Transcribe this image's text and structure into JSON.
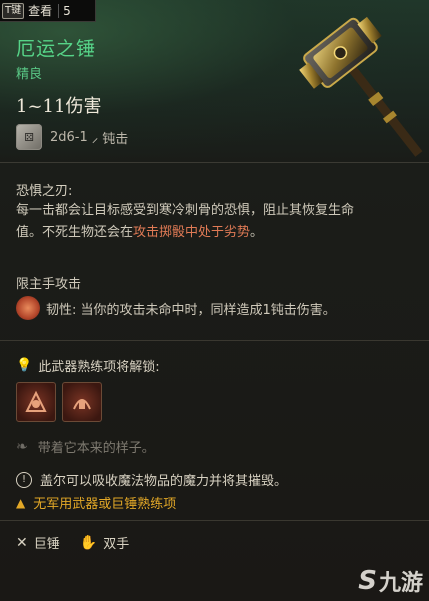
{
  "key_hint": {
    "key": "T键",
    "label": "查看",
    "count": "5"
  },
  "item": {
    "name": "厄运之锤",
    "rarity": "精良",
    "damage": "1~11伤害",
    "dice": "2d6-1",
    "damage_type": "钝击",
    "art_icon": "warhammer-icon"
  },
  "passive": {
    "title": "恐惧之刃:",
    "desc_part1": "每一击都会让目标感受到寒冷刺骨的恐惧，阻止其恢复生命值。不死生物还会在",
    "desc_highlight": "攻击掷骰中处于劣势",
    "desc_part2": "。"
  },
  "restriction": "限主手攻击",
  "toughness": {
    "label": "韧性:",
    "desc": "当你的攻击未命中时，同样造成1钝击伤害。"
  },
  "unlock": {
    "title": "此武器熟练项将解锁:",
    "skills": [
      "skill-brutal-icon",
      "skill-topple-icon"
    ]
  },
  "flavor": "带着它本来的样子。",
  "special": "盖尔可以吸收魔法物品的魔力并将其摧毁。",
  "warning": "无军用武器或巨锤熟练项",
  "tags": {
    "weapon_type": "巨锤",
    "handedness": "双手"
  },
  "watermark": {
    "s": "S",
    "text": "九游"
  },
  "colors": {
    "name_green": "#56d488",
    "warning_yellow": "#e3a827",
    "highlight_red": "#e07a55"
  }
}
